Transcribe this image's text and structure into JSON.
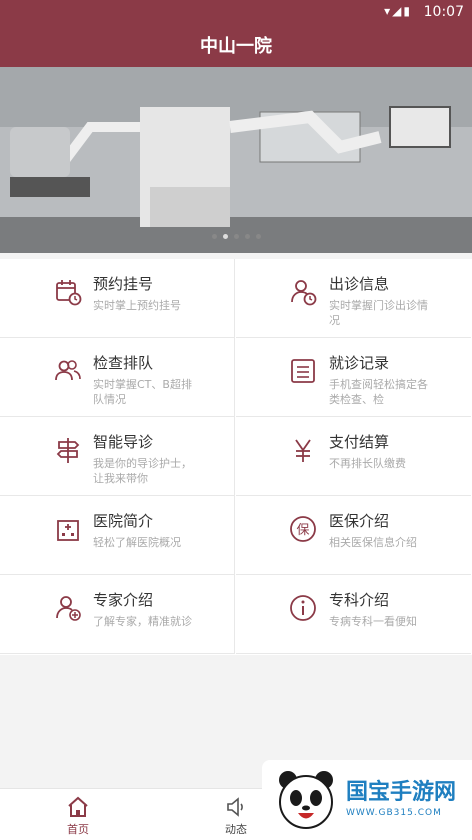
{
  "statusbar": {
    "time": "10:07"
  },
  "appbar": {
    "title": "中山一院"
  },
  "banner": {
    "dot_count": 5,
    "active_dot": 1
  },
  "menu": [
    {
      "title": "预约挂号",
      "desc": "实时掌上预约挂号",
      "icon": "calendar-clock-icon"
    },
    {
      "title": "出诊信息",
      "desc": "实时掌握门诊出诊情况",
      "icon": "doctor-clock-icon"
    },
    {
      "title": "检查排队",
      "desc": "实时掌握CT、B超排队情况",
      "icon": "people-queue-icon"
    },
    {
      "title": "就诊记录",
      "desc": "手机查阅轻松搞定各类检查、检",
      "icon": "record-list-icon"
    },
    {
      "title": "智能导诊",
      "desc": "我是你的导诊护士，让我来带你",
      "icon": "signpost-icon"
    },
    {
      "title": "支付结算",
      "desc": "不再排长队缴费",
      "icon": "yen-icon"
    },
    {
      "title": "医院简介",
      "desc": "轻松了解医院概况",
      "icon": "hospital-icon"
    },
    {
      "title": "医保介绍",
      "desc": "相关医保信息介绍",
      "icon": "insurance-icon"
    },
    {
      "title": "专家介绍",
      "desc": "了解专家，精准就诊",
      "icon": "expert-add-icon"
    },
    {
      "title": "专科介绍",
      "desc": "专病专科一看便知",
      "icon": "info-icon"
    }
  ],
  "tabs": [
    {
      "label": "首页",
      "icon": "home-icon",
      "active": true
    },
    {
      "label": "动态",
      "icon": "speaker-icon",
      "active": false
    }
  ],
  "watermark": {
    "name": "国宝手游网",
    "url": "WWW.GB315.COM"
  },
  "colors": {
    "primary": "#8b3a47",
    "icon": "#8b3a47"
  }
}
